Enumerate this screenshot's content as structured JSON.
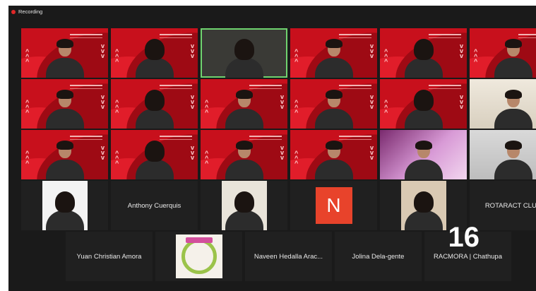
{
  "window": {
    "recording_label": "Recording",
    "recording_color": "#e02828"
  },
  "background_brand_color": "#c8101c",
  "participants": [
    {
      "name": "",
      "tile": "video-red"
    },
    {
      "name": "",
      "tile": "video-red"
    },
    {
      "name": "",
      "tile": "video-plain",
      "active_speaker": true
    },
    {
      "name": "",
      "tile": "video-red"
    },
    {
      "name": "",
      "tile": "video-red"
    },
    {
      "name": "",
      "tile": "video-red"
    },
    {
      "name": "",
      "tile": "video-red"
    },
    {
      "name": "",
      "tile": "video-red"
    },
    {
      "name": "",
      "tile": "video-red"
    },
    {
      "name": "",
      "tile": "video-red"
    },
    {
      "name": "",
      "tile": "video-red"
    },
    {
      "name": "",
      "tile": "video-cream"
    },
    {
      "name": "",
      "tile": "video-red"
    },
    {
      "name": "",
      "tile": "video-red"
    },
    {
      "name": "",
      "tile": "video-red"
    },
    {
      "name": "",
      "tile": "video-red"
    },
    {
      "name": "",
      "tile": "video-lilac"
    },
    {
      "name": "",
      "tile": "video-grey"
    },
    {
      "name": "",
      "tile": "inset-video"
    },
    {
      "name": "Anthony Cuerquis",
      "tile": "name-only"
    },
    {
      "name": "",
      "tile": "inset-video"
    },
    {
      "name": "",
      "tile": "avatar",
      "avatar_letter": "N",
      "avatar_color": "#e8432b"
    },
    {
      "name": "",
      "tile": "inset-video"
    },
    {
      "name": "ROTARACT CLUB",
      "tile": "name-only"
    },
    {
      "name": "Yuan Christian Amora",
      "tile": "name-only"
    },
    {
      "name": "",
      "tile": "poster"
    },
    {
      "name": "Naveen Hedalla Arac...",
      "tile": "name-only"
    },
    {
      "name": "Jolina Dela-gente",
      "tile": "name-only"
    },
    {
      "name": "RACMORA | Chathupa",
      "tile": "name-only"
    }
  ],
  "page_counter": "16"
}
